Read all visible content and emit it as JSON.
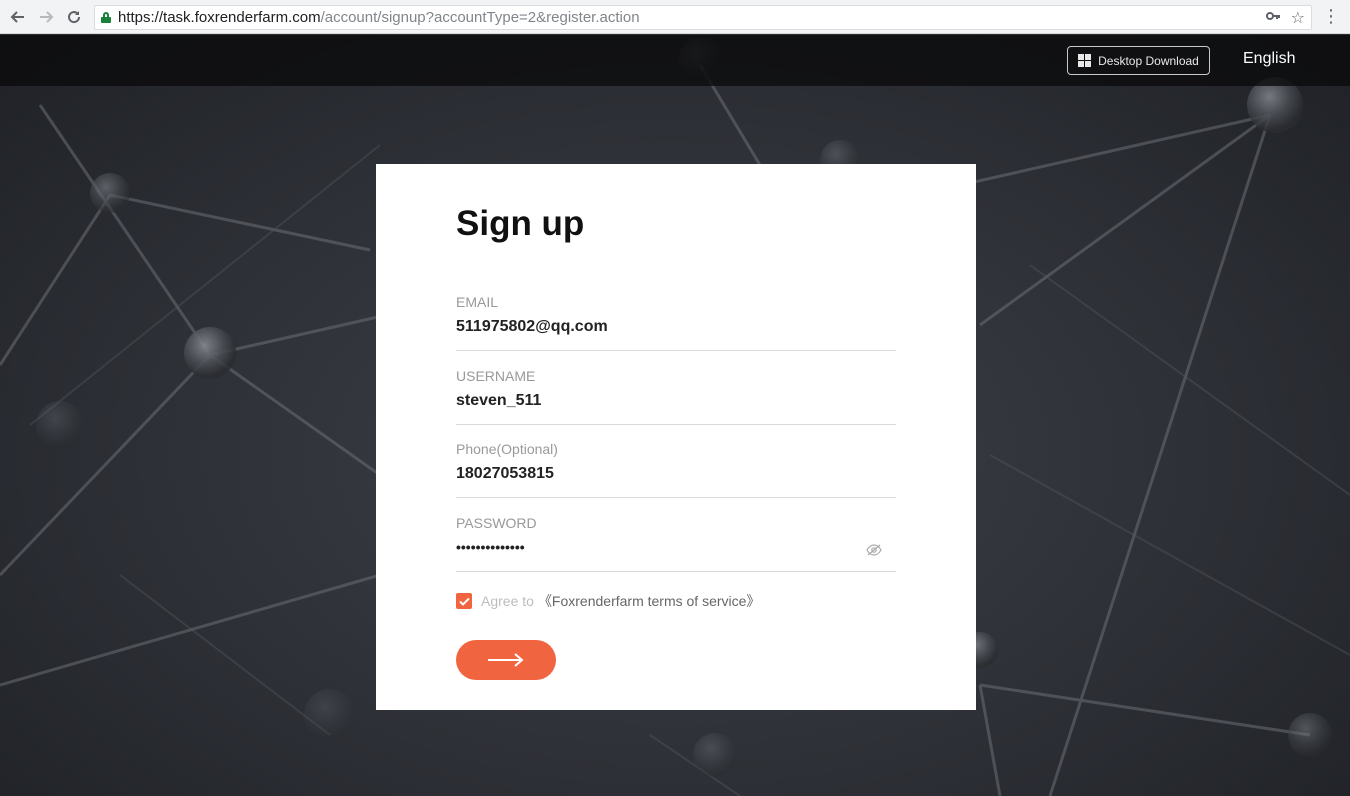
{
  "browser": {
    "url_host": "https://task.foxrenderfarm.com",
    "url_path": "/account/signup?accountType=2&register.action"
  },
  "header": {
    "download_label": "Desktop Download",
    "language": "English"
  },
  "form": {
    "title": "Sign up",
    "email_label": "EMAIL",
    "email_value": "511975802@qq.com",
    "username_label": "USERNAME",
    "username_value": "steven_511",
    "phone_label": "Phone(Optional)",
    "phone_value": "18027053815",
    "password_label": "PASSWORD",
    "password_value": "••••••••••••••",
    "agree_text": "Agree to",
    "terms_link": "《Foxrenderfarm terms of service》",
    "agree_checked": true
  },
  "colors": {
    "accent": "#f0653f"
  }
}
